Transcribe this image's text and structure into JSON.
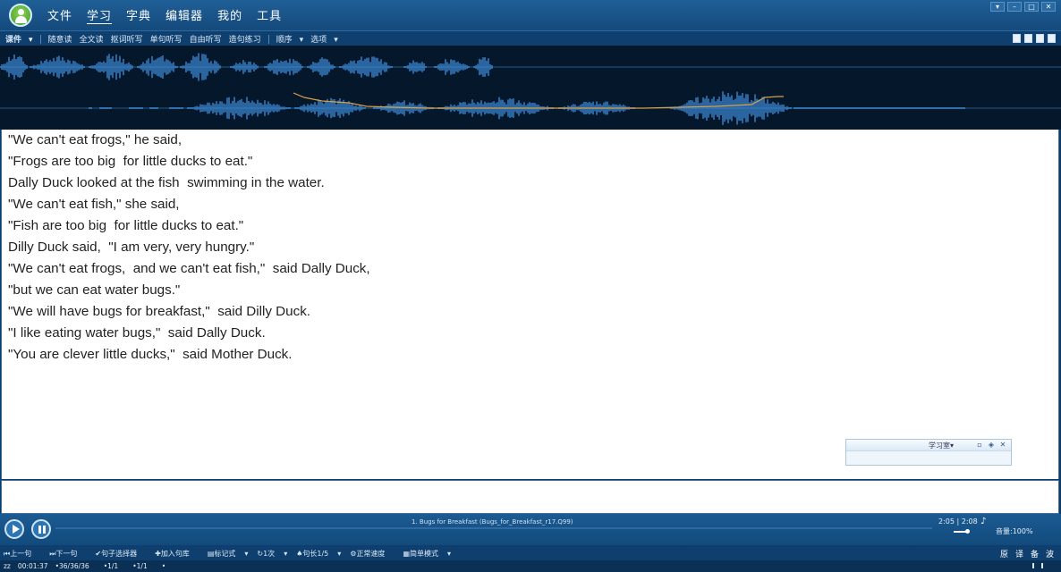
{
  "main_menu": [
    "文件",
    "学习",
    "字典",
    "编辑器",
    "我的",
    "工具"
  ],
  "sub_toolbar": {
    "course": "课件",
    "modes": [
      "随意读",
      "全文读",
      "抠词听写",
      "单句听写",
      "自由听写",
      "造句练习"
    ],
    "order": "顺序",
    "options": "选项"
  },
  "transcript": [
    "\"We can't eat frogs,\" he said,",
    "\"Frogs are too big  for little ducks to eat.\"",
    "Dally Duck looked at the fish  swimming in the water.",
    "\"We can't eat fish,\" she said,",
    "\"Fish are too big  for little ducks to eat.\"",
    "Dilly Duck said,  \"I am very, very hungry.\"",
    "\"We can't eat frogs,  and we can't eat fish,\"  said Dally Duck,",
    "\"but we can eat water bugs.\"",
    "\"We will have bugs for breakfast,\"  said Dilly Duck.",
    "\"I like eating water bugs,\"  said Dally Duck.",
    "\"You are clever little ducks,\"  said Mother Duck."
  ],
  "popup": {
    "tab_label": "学习室"
  },
  "player": {
    "track_name": "1. Bugs for Breakfast (Bugs_for_Breakfast_r17.Q99)",
    "time": "2:05 | 2:08",
    "volume_label": "音量:100%"
  },
  "controls": {
    "prev": "上一句",
    "next": "下一句",
    "sentence_selector": "句子选择器",
    "add_to_library": "加入句库",
    "marker": "标记式",
    "repeat": "1次",
    "sentence_length": "句长1/5",
    "speed": "正常速度",
    "mode": "简单模式",
    "right_labels": [
      "原",
      "译",
      "备",
      "波"
    ]
  },
  "status": {
    "sleep": "zz",
    "elapsed": "00:01:37",
    "sentence_count": "36/36/36",
    "page_a": "1/1",
    "page_b": "1/1"
  },
  "colors": {
    "waveform": "#3f8fe0",
    "pitch_line": "#d8a04a",
    "bar": "#1b5b92"
  }
}
